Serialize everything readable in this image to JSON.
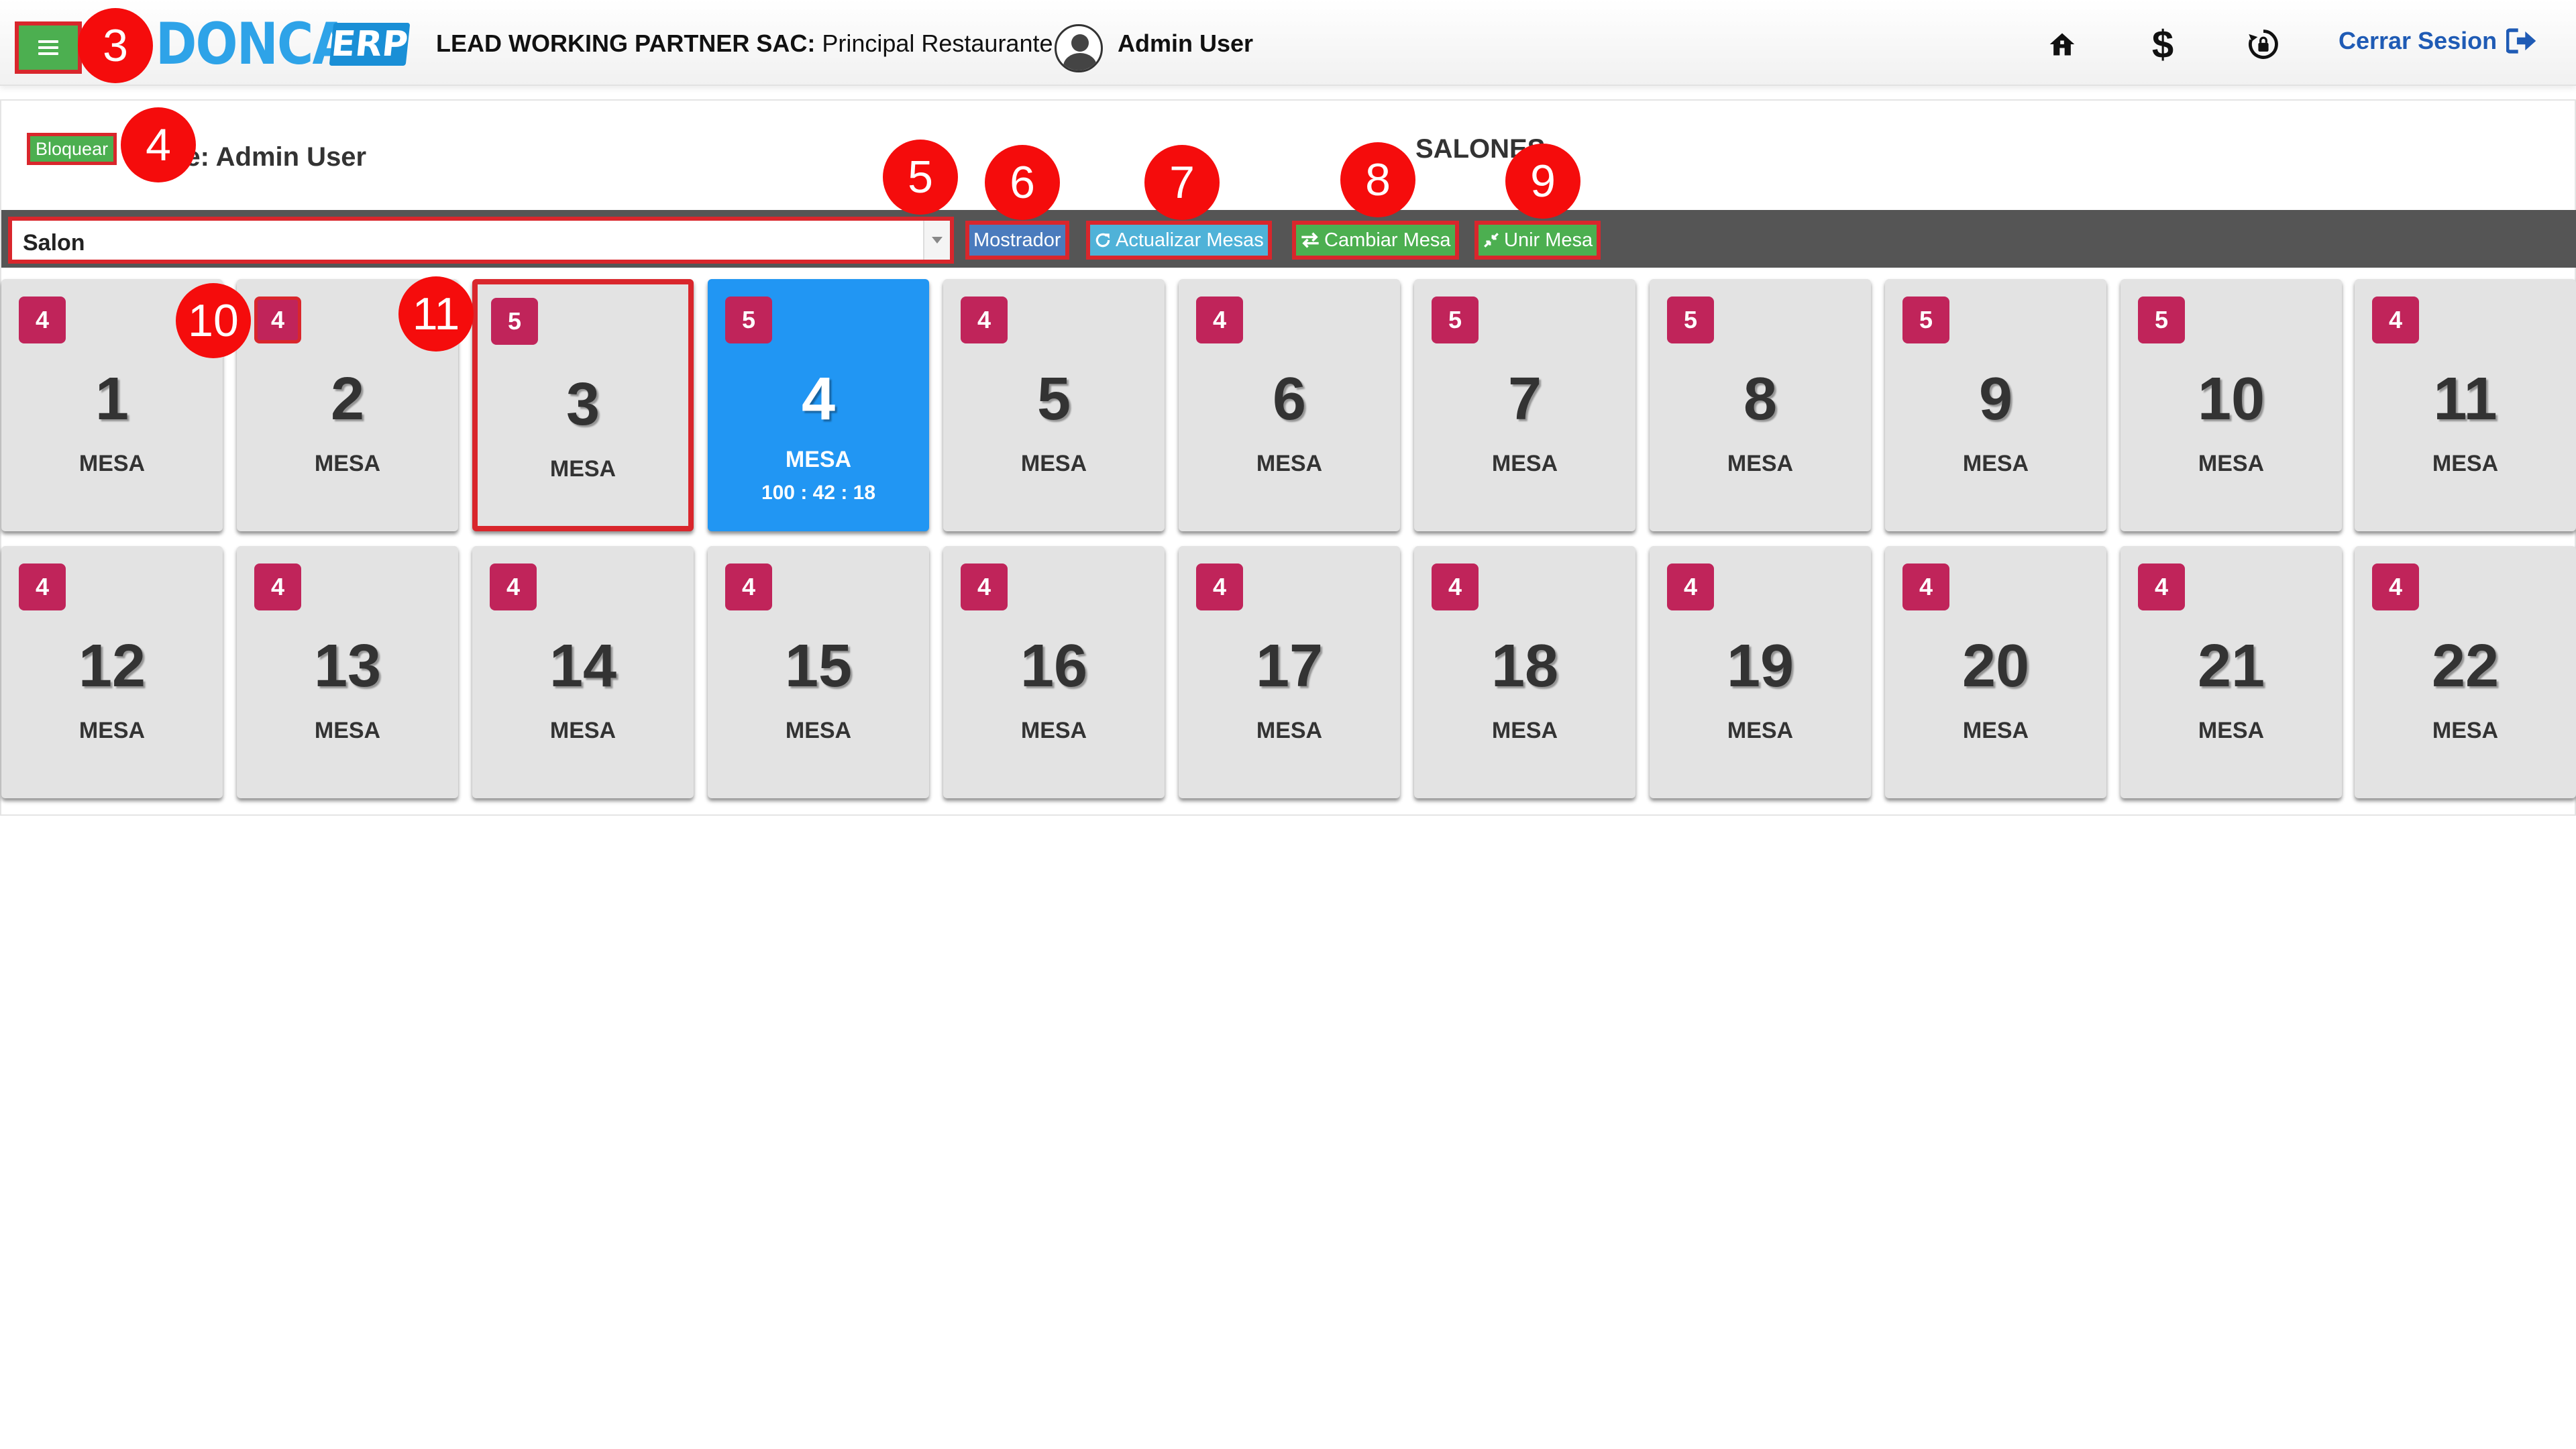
{
  "header": {
    "logo_text": "DONCA",
    "logo_badge": "ERP",
    "company_bold": "LEAD WORKING PARTNER SAC:",
    "company_rest": " Principal Restaurante |",
    "user_name": "Admin User",
    "logout_label": "Cerrar Sesion"
  },
  "panel": {
    "lock_label": "Bloquear",
    "mozo_text": "de: Admin User",
    "title": "SALONES"
  },
  "toolbar": {
    "salon_value": "Salon",
    "mostrador_label": "Mostrador",
    "actualizar_label": "Actualizar Mesas",
    "cambiar_label": "Cambiar Mesa",
    "unir_label": "Unir Mesa"
  },
  "tables": [
    {
      "number": "1",
      "capacity": "4",
      "label": "MESA"
    },
    {
      "number": "2",
      "capacity": "4",
      "label": "MESA"
    },
    {
      "number": "3",
      "capacity": "5",
      "label": "MESA"
    },
    {
      "number": "4",
      "capacity": "5",
      "label": "MESA",
      "timer": "100 : 42 : 18"
    },
    {
      "number": "5",
      "capacity": "4",
      "label": "MESA"
    },
    {
      "number": "6",
      "capacity": "4",
      "label": "MESA"
    },
    {
      "number": "7",
      "capacity": "5",
      "label": "MESA"
    },
    {
      "number": "8",
      "capacity": "5",
      "label": "MESA"
    },
    {
      "number": "9",
      "capacity": "5",
      "label": "MESA"
    },
    {
      "number": "10",
      "capacity": "5",
      "label": "MESA"
    },
    {
      "number": "11",
      "capacity": "4",
      "label": "MESA"
    },
    {
      "number": "12",
      "capacity": "4",
      "label": "MESA"
    },
    {
      "number": "13",
      "capacity": "4",
      "label": "MESA"
    },
    {
      "number": "14",
      "capacity": "4",
      "label": "MESA"
    },
    {
      "number": "15",
      "capacity": "4",
      "label": "MESA"
    },
    {
      "number": "16",
      "capacity": "4",
      "label": "MESA"
    },
    {
      "number": "17",
      "capacity": "4",
      "label": "MESA"
    },
    {
      "number": "18",
      "capacity": "4",
      "label": "MESA"
    },
    {
      "number": "19",
      "capacity": "4",
      "label": "MESA"
    },
    {
      "number": "20",
      "capacity": "4",
      "label": "MESA"
    },
    {
      "number": "21",
      "capacity": "4",
      "label": "MESA"
    },
    {
      "number": "22",
      "capacity": "4",
      "label": "MESA"
    }
  ],
  "callouts": [
    "3",
    "4",
    "5",
    "6",
    "7",
    "8",
    "9",
    "10",
    "11"
  ],
  "colors": {
    "primary_green": "#4caf50",
    "active_table": "#2196f3",
    "capacity_badge": "#c0245a",
    "highlight_red": "#d9262c",
    "logout_blue": "#1f5bb5"
  }
}
